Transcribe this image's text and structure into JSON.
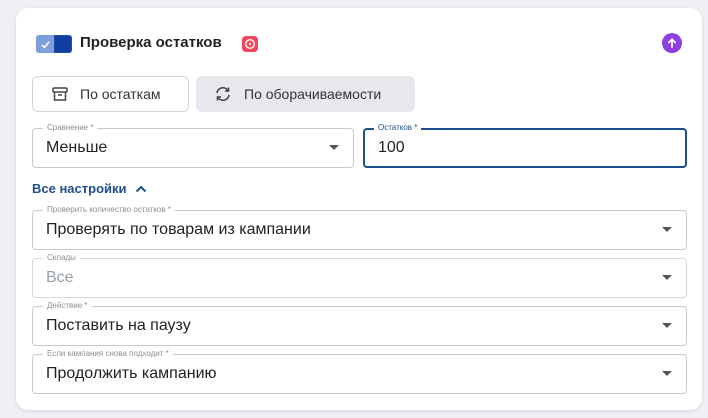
{
  "header": {
    "title": "Проверка остатков",
    "toggle_on": true,
    "accent": "#1e4fa8",
    "badge_color": "#f0475a",
    "upload_color": "#8e3fe0"
  },
  "modes": {
    "by_stock": {
      "label": "По остаткам",
      "icon": "archive-icon",
      "selected": false
    },
    "by_turnover": {
      "label": "По оборачиваемости",
      "icon": "sync-icon",
      "selected": true
    }
  },
  "comparison": {
    "label": "Сравнение *",
    "value": "Меньше"
  },
  "stock_amount": {
    "label": "Остатков *",
    "value": "100"
  },
  "all_settings": {
    "label": "Все настройки",
    "expanded": true
  },
  "check_quantity": {
    "label": "Проверить количество остатков *",
    "value": "Проверять по товарам из кампании"
  },
  "warehouses": {
    "label": "Склады",
    "value": "Все"
  },
  "action": {
    "label": "Действие *",
    "value": "Поставить на паузу"
  },
  "if_matches": {
    "label": "Если кампания снова подходит *",
    "value": "Продолжить кампанию"
  }
}
